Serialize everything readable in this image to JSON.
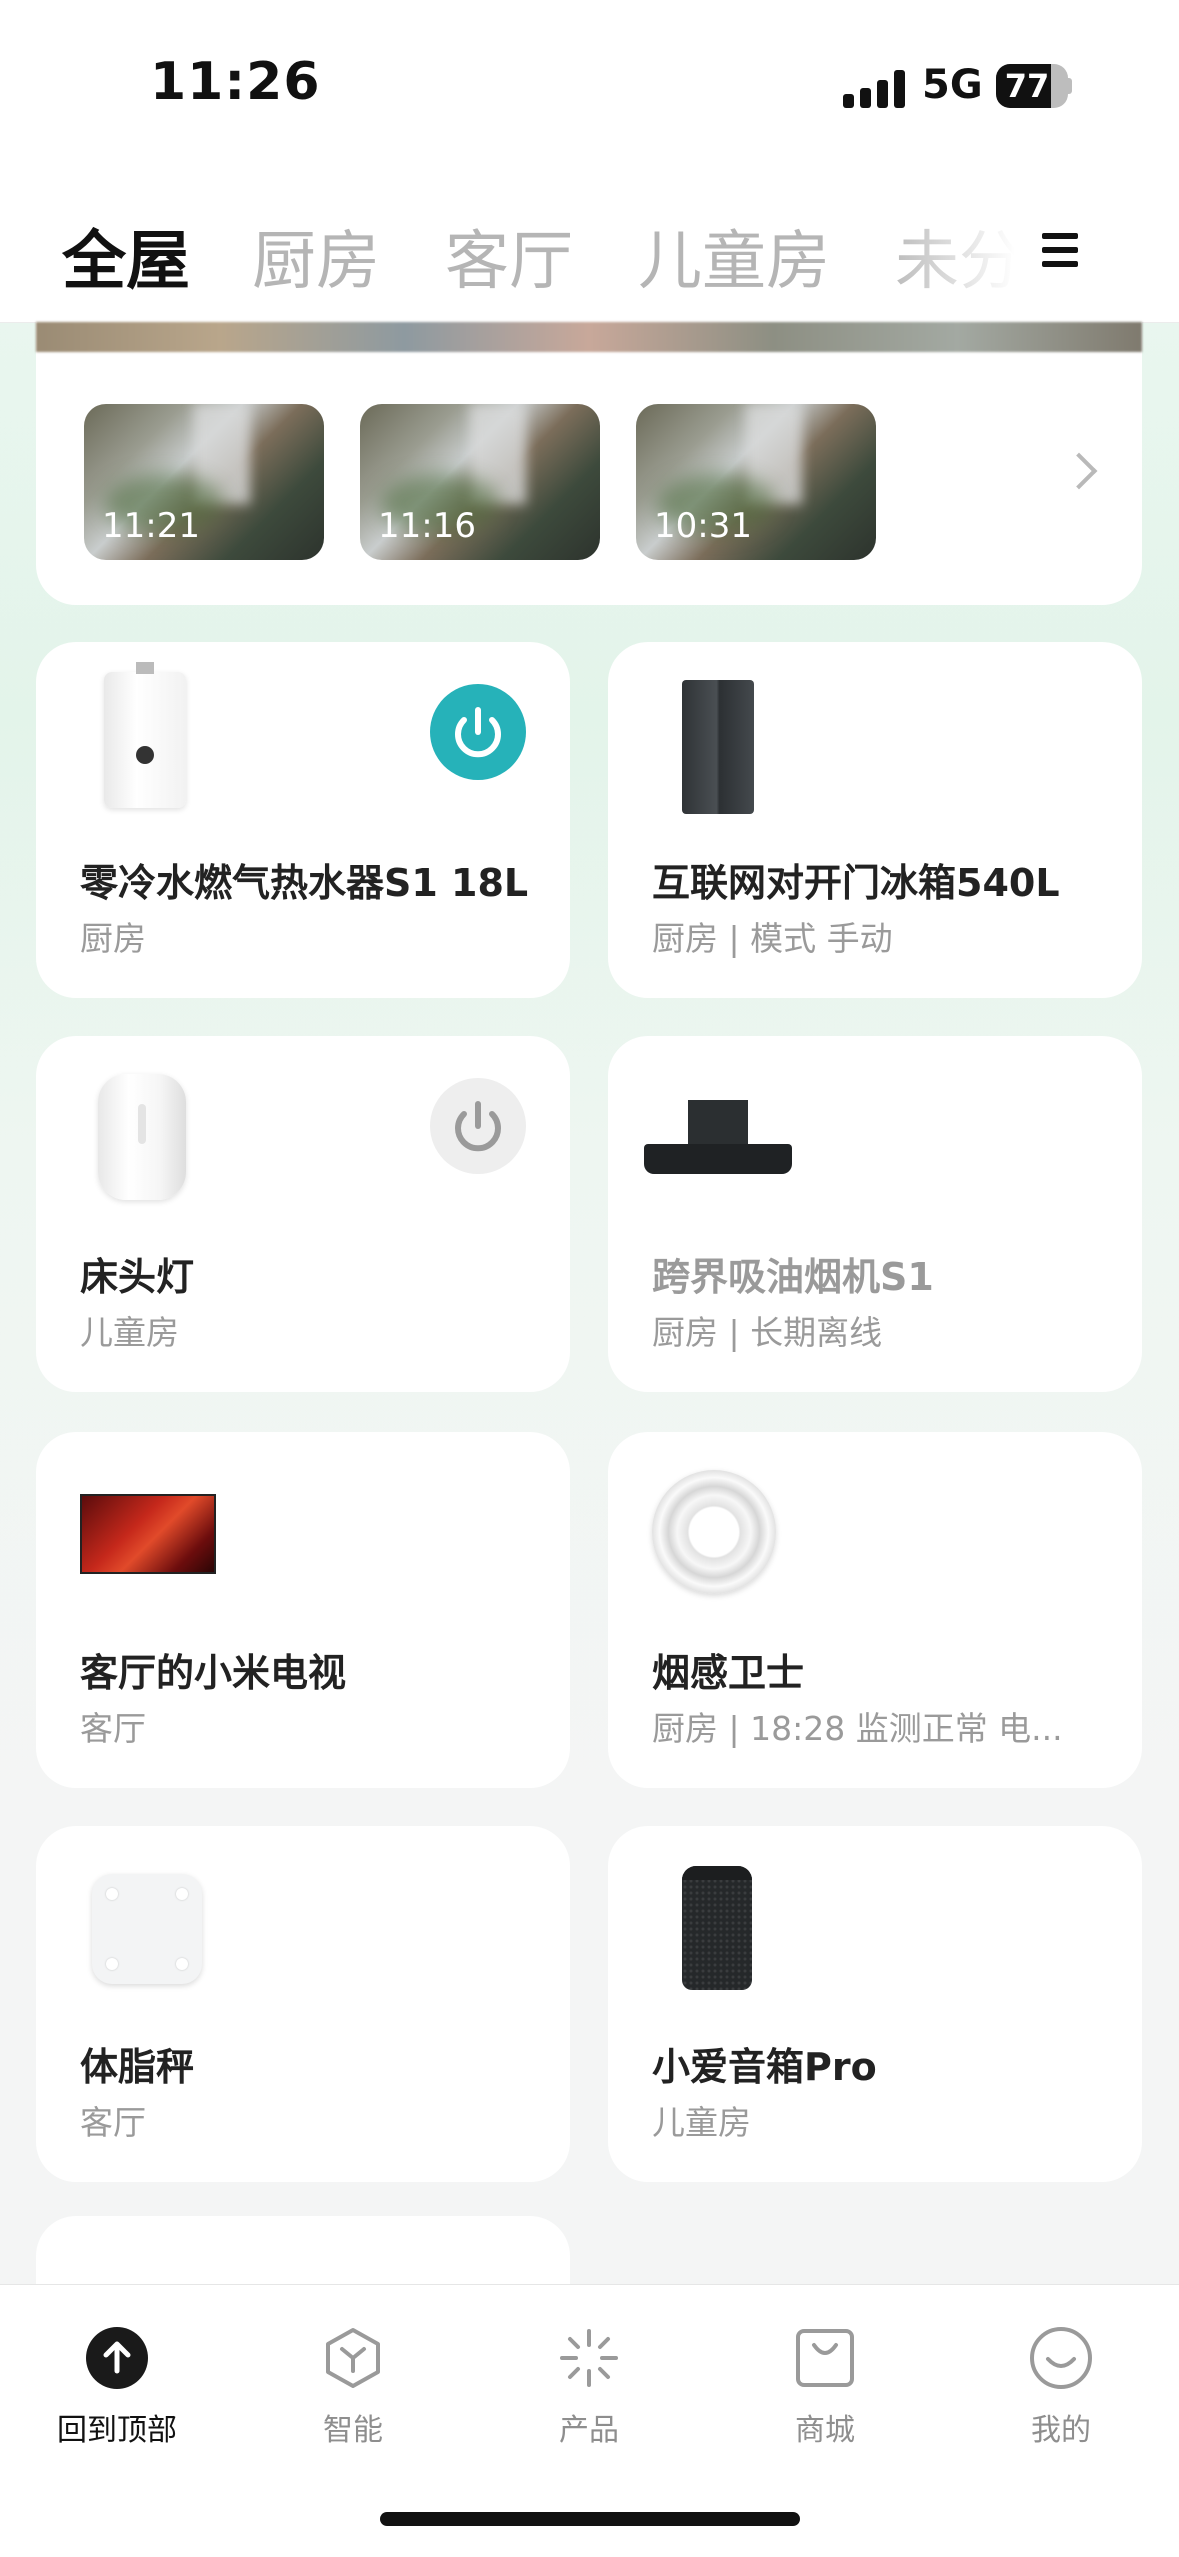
{
  "status_bar": {
    "time": "11:26",
    "network": "5G",
    "battery": "77",
    "battery_level": 0.77
  },
  "tabs": [
    {
      "label": "全屋",
      "active": true
    },
    {
      "label": "厨房",
      "active": false
    },
    {
      "label": "客厅",
      "active": false
    },
    {
      "label": "儿童房",
      "active": false
    },
    {
      "label": "未分",
      "active": false
    }
  ],
  "camera": {
    "clips": [
      {
        "time": "11:21"
      },
      {
        "time": "11:16"
      },
      {
        "time": "10:31"
      }
    ]
  },
  "devices": [
    {
      "name": "零冷水燃气热水器S1 18L",
      "sub": "厨房",
      "icon": "water-heater",
      "power": "on"
    },
    {
      "name": "互联网对开门冰箱540L",
      "sub": "厨房 | 模式 手动",
      "icon": "refrigerator"
    },
    {
      "name": "床头灯",
      "sub": "儿童房",
      "icon": "bedside-lamp",
      "power": "off"
    },
    {
      "name": "跨界吸油烟机S1",
      "sub": "厨房 | 长期离线",
      "icon": "range-hood",
      "offline": true
    },
    {
      "name": "客厅的小米电视",
      "sub": "客厅",
      "icon": "television"
    },
    {
      "name": "烟感卫士",
      "sub": "厨房 | 18:28 监测正常 电...",
      "icon": "smoke-detector"
    },
    {
      "name": "体脂秤",
      "sub": "客厅",
      "icon": "body-fat-scale"
    },
    {
      "name": "小爱音箱Pro",
      "sub": "儿童房",
      "icon": "smart-speaker"
    }
  ],
  "bottom_nav": [
    {
      "label": "回到顶部",
      "icon": "back-to-top-icon",
      "active": true
    },
    {
      "label": "智能",
      "icon": "cube-icon",
      "active": false
    },
    {
      "label": "产品",
      "icon": "sparkle-icon",
      "active": false
    },
    {
      "label": "商城",
      "icon": "shopping-bag-icon",
      "active": false
    },
    {
      "label": "我的",
      "icon": "smile-icon",
      "active": false
    }
  ],
  "colors": {
    "power_on": "#26b2b9",
    "power_off": "#eeeeee",
    "inactive_text": "#9a9a9a"
  }
}
